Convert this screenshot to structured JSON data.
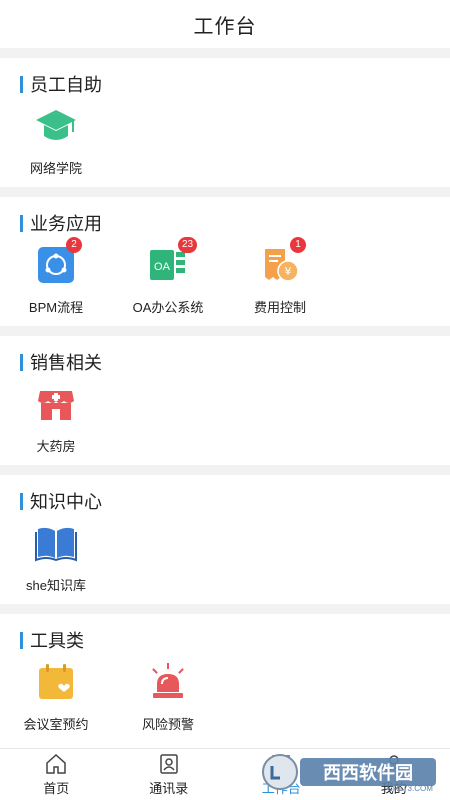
{
  "header": {
    "title": "工作台"
  },
  "sections": [
    {
      "title": "员工自助",
      "apps": [
        {
          "label": "网络学院",
          "icon": "graduation-cap-icon",
          "badge": ""
        }
      ]
    },
    {
      "title": "业务应用",
      "apps": [
        {
          "label": "BPM流程",
          "icon": "bpm-flow-icon",
          "badge": "2"
        },
        {
          "label": "OA办公系统",
          "icon": "oa-icon",
          "badge": "23"
        },
        {
          "label": "费用控制",
          "icon": "expense-icon",
          "badge": "1"
        }
      ]
    },
    {
      "title": "销售相关",
      "apps": [
        {
          "label": "大药房",
          "icon": "pharmacy-store-icon",
          "badge": ""
        }
      ]
    },
    {
      "title": "知识中心",
      "apps": [
        {
          "label": "she知识库",
          "icon": "book-icon",
          "badge": ""
        }
      ]
    },
    {
      "title": "工具类",
      "apps": [
        {
          "label": "会议室预约",
          "icon": "calendar-heart-icon",
          "badge": ""
        },
        {
          "label": "风险预警",
          "icon": "alarm-light-icon",
          "badge": ""
        }
      ]
    }
  ],
  "tabbar": {
    "items": [
      {
        "label": "首页",
        "icon": "home-icon"
      },
      {
        "label": "通讯录",
        "icon": "contacts-icon"
      },
      {
        "label": "工作台",
        "icon": "workbench-icon"
      },
      {
        "label": "我的",
        "icon": "profile-icon"
      }
    ],
    "active_index": 2
  },
  "watermark": {
    "text": "西西软件园",
    "subtext": "CR173.COM"
  },
  "colors": {
    "accent": "#2f8fd8",
    "badge": "#e8383d",
    "green": "#3cc08a",
    "orange": "#f5a04a",
    "red": "#e8585a",
    "blue": "#3a7bd5",
    "gold": "#f2b83a"
  }
}
